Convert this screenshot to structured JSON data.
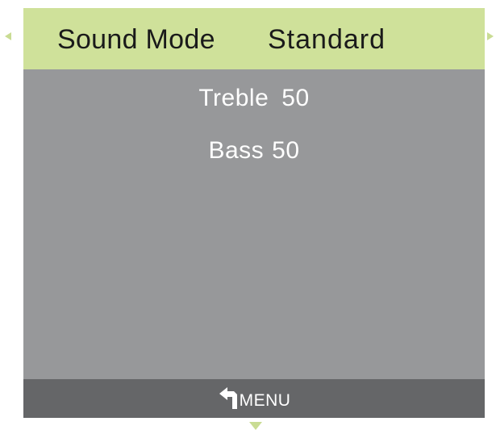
{
  "header": {
    "label": "Sound Mode",
    "value": "Standard"
  },
  "settings": [
    {
      "label": "Treble",
      "value": "50"
    },
    {
      "label": "Bass",
      "value": "50"
    }
  ],
  "footer": {
    "icon": "return-arrow-icon",
    "label": "MENU"
  },
  "colors": {
    "header_bg": "#cfe19a",
    "panel_bg": "#97989a",
    "footer_bg": "#656668",
    "arrow": "#c9dc93"
  }
}
